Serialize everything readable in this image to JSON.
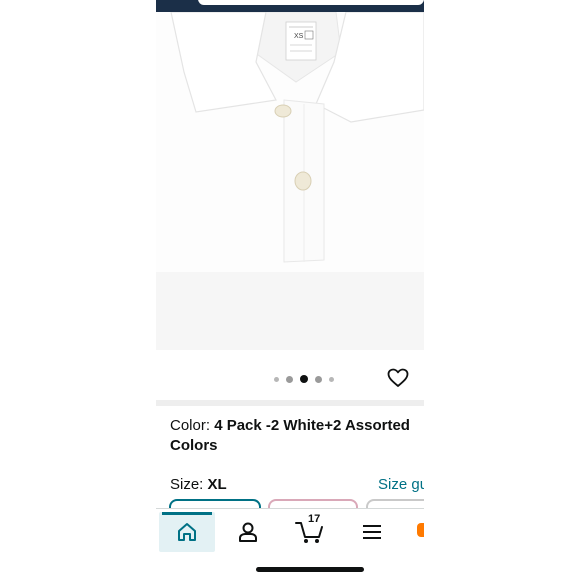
{
  "product": {
    "image_alt": "white polo shirt collar close-up",
    "tag_size": "XS"
  },
  "carousel": {
    "dot_count": 5,
    "active_index": 2
  },
  "color": {
    "label": "Color: ",
    "value": "4 Pack -2 White+2 Assorted Colors"
  },
  "size": {
    "label": "Size: ",
    "value": "XL",
    "guide_label": "Size gu"
  },
  "nav": {
    "cart_count": "17"
  },
  "colors": {
    "accent": "#007185",
    "header": "#1b2f48",
    "home_bg": "#e3f1f4",
    "orange": "#ff7a00"
  }
}
